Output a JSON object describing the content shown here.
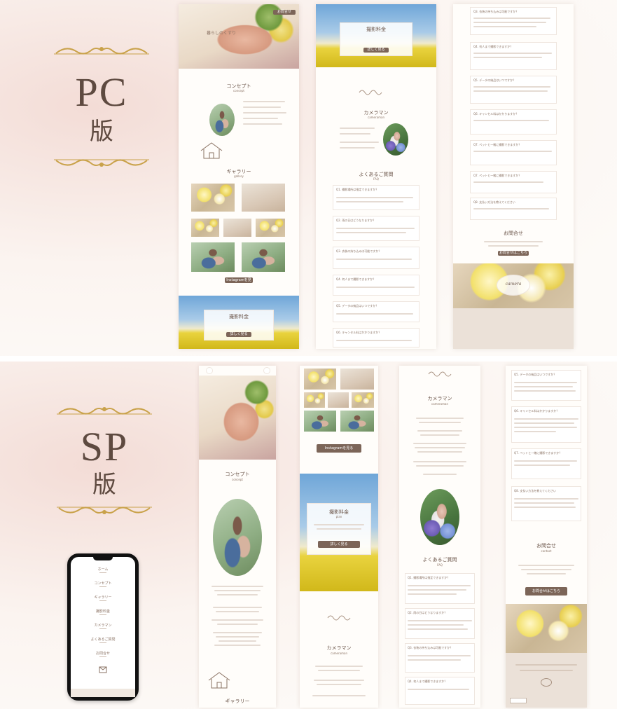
{
  "pc": {
    "title": "PC",
    "subtitle": "版"
  },
  "sp": {
    "title": "SP",
    "subtitle": "版"
  },
  "site": {
    "hero_text": "暮らしのくすり",
    "section_concept": "コンセプト",
    "section_concept_en": "concept",
    "section_gallery": "ギャラリー",
    "section_gallery_en": "gallery",
    "instagram_button": "Instagramを見る",
    "booking_title": "撮影料金",
    "booking_en": "plan",
    "booking_button": "詳しく見る",
    "section_cameraman": "カメラマン",
    "section_cameraman_en": "cameraman",
    "section_faq": "よくあるご質問",
    "section_faq_en": "FAQ",
    "contact_title": "お問合せ",
    "contact_en": "contact",
    "contact_button": "お問合せはこちら",
    "logo_text": "camera"
  },
  "faq": [
    "Q1. 撮影場所は指定できますか？",
    "Q2. 雨の日はどうなりますか？",
    "Q3. 衣装の持ち込みは可能ですか？",
    "Q4. 何人まで撮影できますか？",
    "Q5. データの納品はいつですか？",
    "Q6. キャンセル料はかかりますか？",
    "Q7. ペットと一緒に撮影できますか？",
    "Q8. 支払い方法を教えてください"
  ],
  "phone_menu": [
    "ホーム",
    "コンセプト",
    "ギャラリー",
    "撮影料金",
    "カメラマン",
    "よくあるご質問",
    "お問合せ"
  ],
  "colors": {
    "accent": "#7c6558",
    "gold": "#c9a24a",
    "text": "#6a5448"
  }
}
